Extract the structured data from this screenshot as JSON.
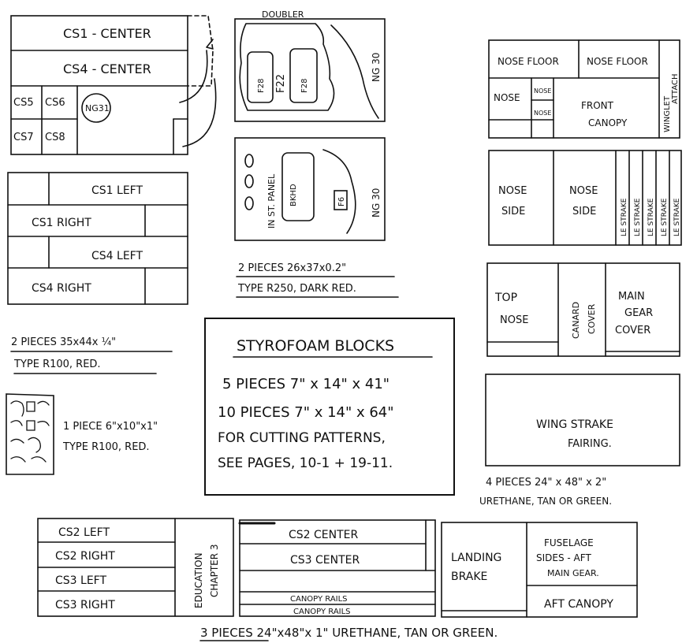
{
  "panel_a": {
    "cs1_center": "CS1 - CENTER",
    "cs4_center": "CS4 - CENTER",
    "cs5": "CS5",
    "cs6": "CS6",
    "cs7": "CS7",
    "cs8": "CS8",
    "ng31": "NG31"
  },
  "panel_b": {
    "cs1_left": "CS1 LEFT",
    "cs1_right": "CS1 RIGHT",
    "cs4_left": "CS4 LEFT",
    "cs4_right": "CS4 RIGHT",
    "caption_line1": "2 PIECES 35x44x ¼\"",
    "caption_line2": "TYPE R100, RED."
  },
  "panel_c": {
    "caption_line1": "1 PIECE 6\"x10\"x1\"",
    "caption_line2": "TYPE R100, RED."
  },
  "panel_d": {
    "doubler": "DOUBLER",
    "f28_left": "F28",
    "f22": "F22",
    "f28_right": "F28",
    "ng30": "NG 30"
  },
  "panel_e": {
    "inst_panel": "IN ST. PANEL",
    "bkhd": "BKHD",
    "f6": "F6",
    "ng30": "NG 30",
    "caption_line1": "2 PIECES 26x37x0.2\"",
    "caption_line2": "TYPE R250, DARK RED."
  },
  "styrofoam": {
    "title": "STYROFOAM BLOCKS",
    "line1": "5 PIECES  7\" x 14\" x 41\"",
    "line2": "10 PIECES  7\" x 14\" x 64\"",
    "line3": "FOR CUTTING PATTERNS,",
    "line4": "SEE PAGES, 10-1 + 19-11."
  },
  "panel_f": {
    "nose_floor_1": "NOSE FLOOR",
    "nose_floor_2": "NOSE FLOOR",
    "nose": "NOSE",
    "nose_small_1": "NOSE",
    "nose_small_2": "NOSE",
    "front_canopy_1": "FRONT",
    "front_canopy_2": "CANOPY",
    "winglet_1": "WINGLET",
    "winglet_2": "ATTACH"
  },
  "panel_g": {
    "nose_side_1a": "NOSE",
    "nose_side_1b": "SIDE",
    "nose_side_2a": "NOSE",
    "nose_side_2b": "SIDE",
    "le_strake": "LE STRAKE"
  },
  "panel_h": {
    "top_nose_1": "TOP",
    "top_nose_2": "NOSE",
    "canard_1": "CANARD",
    "canard_2": "COVER",
    "main_gear_1": "MAIN",
    "main_gear_2": "GEAR",
    "main_gear_3": "COVER"
  },
  "panel_i": {
    "wing_strake_1": "WING STRAKE",
    "wing_strake_2": "FAIRING.",
    "caption_line1": "4 PIECES  24\" x 48\" x 2\"",
    "caption_line2": "URETHANE, TAN OR GREEN."
  },
  "panel_j": {
    "cs2_left": "CS2 LEFT",
    "cs2_right": "CS2 RIGHT",
    "cs3_left": "CS3 LEFT",
    "cs3_right": "CS3 RIGHT",
    "education_1": "EDUCATION",
    "education_2": "CHAPTER 3"
  },
  "panel_k": {
    "cs2_center": "CS2 CENTER",
    "cs3_center": "CS3 CENTER",
    "canopy_rails_1": "CANOPY RAILS",
    "canopy_rails_2": "CANOPY RAILS"
  },
  "panel_l": {
    "landing_1": "LANDING",
    "landing_2": "BRAKE",
    "fuselage_1": "FUSELAGE",
    "fuselage_2": "SIDES - AFT",
    "fuselage_3": "MAIN GEAR.",
    "aft_canopy": "AFT CANOPY"
  },
  "footer": {
    "caption": "3 PIECES  24\"x48\"x 1\"  URETHANE, TAN OR GREEN."
  }
}
